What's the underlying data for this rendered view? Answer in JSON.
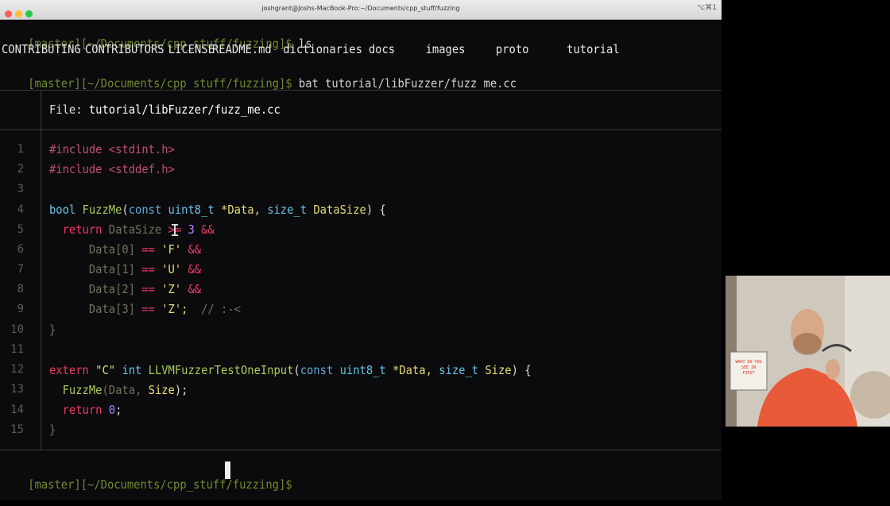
{
  "window": {
    "title": "joshgrant@Joshs-MacBook-Pro:~/Documents/cpp_stuff/fuzzing",
    "shortcut": "⌥⌘1",
    "light_colors": [
      "#ff5f57",
      "#febc2e",
      "#28c840"
    ]
  },
  "terminal": {
    "prompt_branch": "[master]",
    "prompt_path": "[~/Documents/cpp_stuff/fuzzing]$",
    "cmd1": "ls",
    "ls_items": [
      "CONTRIBUTING",
      "CONTRIBUTORS",
      "LICENSE",
      "README.md",
      "dictionaries",
      "docs",
      "images",
      "proto",
      "tutorial"
    ],
    "cmd2": "bat tutorial/libFuzzer/fuzz_me.cc"
  },
  "bat": {
    "file_label": "File:",
    "file_path": "tutorial/libFuzzer/fuzz_me.cc",
    "line_numbers": [
      "1",
      "2",
      "3",
      "4",
      "5",
      "6",
      "7",
      "8",
      "9",
      "10",
      "11",
      "12",
      "13",
      "14",
      "15"
    ]
  },
  "code": {
    "l1": [
      "#include",
      "<stdint.h>"
    ],
    "l2": [
      "#include",
      "<stddef.h>"
    ],
    "l4": [
      "bool",
      "FuzzMe",
      "(",
      "const",
      "uint8_t",
      "*Data,",
      "size_t",
      "DataSize",
      ") {"
    ],
    "l5": [
      "return",
      "DataSize",
      ">=",
      "3",
      "&&"
    ],
    "l6": [
      "Data[0]",
      "==",
      "'F'",
      "&&"
    ],
    "l7": [
      "Data[1]",
      "==",
      "'U'",
      "&&"
    ],
    "l8": [
      "Data[2]",
      "==",
      "'Z'",
      "&&"
    ],
    "l9": [
      "Data[3]",
      "==",
      "'Z';",
      "// :-<"
    ],
    "l10": "}",
    "l12": [
      "extern",
      "\"C\"",
      "int",
      "LLVMFuzzerTestOneInput",
      "(",
      "const",
      "uint8_t",
      "*Data,",
      "size_t",
      "Size",
      ") {"
    ],
    "l13": [
      "FuzzMe",
      "(Data,",
      "Size",
      ");"
    ],
    "l14": [
      "return",
      "0",
      ";"
    ],
    "l15": "}"
  },
  "webcam": {
    "label": "presenter-video",
    "poster_text": [
      "WHAT DO YOU",
      "SEE IN",
      "FIRST"
    ]
  }
}
